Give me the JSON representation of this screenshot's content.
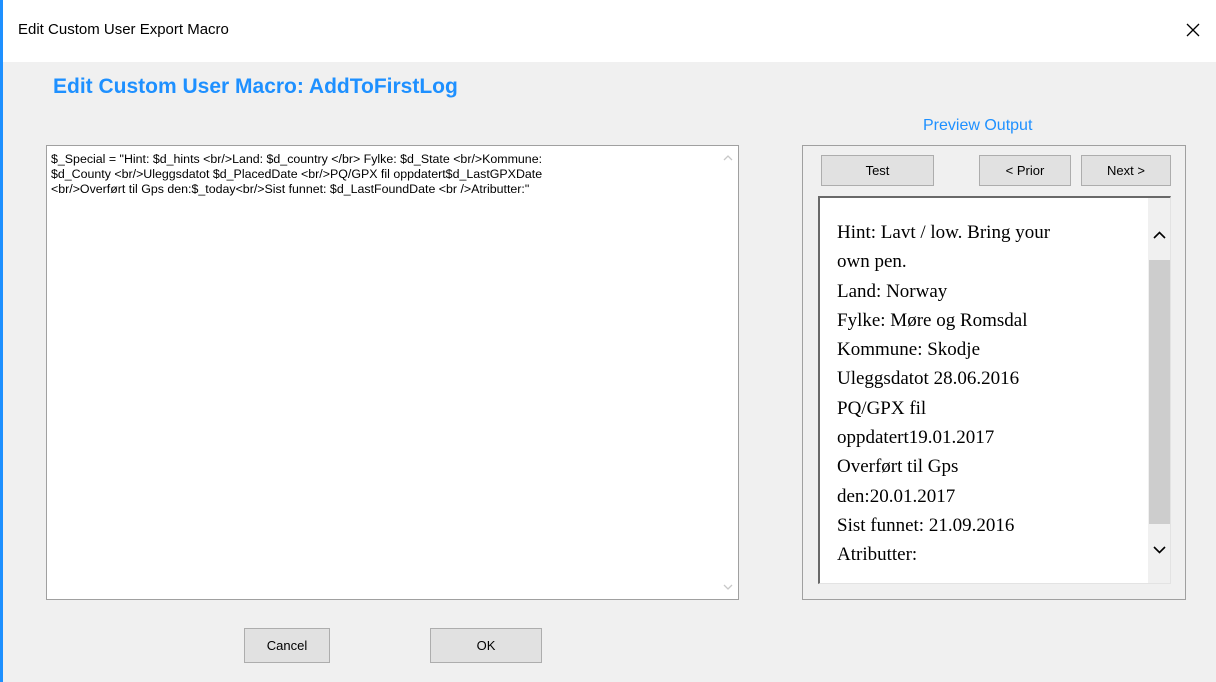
{
  "window": {
    "title": "Edit Custom User Export Macro",
    "close_icon": "close-icon"
  },
  "dialog": {
    "heading": "Edit Custom User Macro: AddToFirstLog",
    "editor": {
      "value": "$_Special = \"Hint: $d_hints <br/>Land: $d_country </br> Fylke: $d_State <br/>Kommune:\n$d_County <br/>Uleggsdatot $d_PlacedDate <br/>PQ/GPX fil oppdatert$d_LastGPXDate\n<br/>Overført til Gps den:$_today<br/>Sist funnet: $d_LastFoundDate <br />Atributter:\""
    },
    "preview": {
      "label": "Preview Output",
      "test_label": "Test",
      "prior_label": "< Prior",
      "next_label": "Next >",
      "lines": [
        "Hint: Lavt / low. Bring your",
        "own pen.",
        "Land: Norway",
        "Fylke: Møre og Romsdal",
        "Kommune: Skodje",
        "Uleggsdatot 28.06.2016",
        "PQ/GPX fil",
        "oppdatert19.01.2017",
        "Overført til Gps",
        "den:20.01.2017",
        "Sist funnet: 21.09.2016",
        "Atributter:"
      ]
    },
    "buttons": {
      "cancel_label": "Cancel",
      "ok_label": "OK"
    }
  },
  "colors": {
    "accent": "#1e90ff",
    "background": "#f0f0f0",
    "button": "#e1e1e1"
  }
}
